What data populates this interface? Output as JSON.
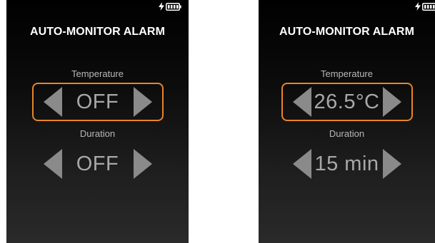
{
  "colors": {
    "highlight": "#e8842a",
    "text": "#ffffff",
    "label": "#b8b8b8",
    "value": "#a8a8a8",
    "arrow": "#8a8a8a"
  },
  "status_icons": [
    "charging-bolt-icon",
    "battery-icon"
  ],
  "screens": [
    {
      "title": "AUTO-MONITOR ALARM",
      "temperature": {
        "label": "Temperature",
        "value": "OFF",
        "selected": true
      },
      "duration": {
        "label": "Duration",
        "value": "OFF",
        "selected": false
      }
    },
    {
      "title": "AUTO-MONITOR ALARM",
      "temperature": {
        "label": "Temperature",
        "value": "26.5°C",
        "selected": true
      },
      "duration": {
        "label": "Duration",
        "value": "15 min",
        "selected": false
      }
    }
  ]
}
